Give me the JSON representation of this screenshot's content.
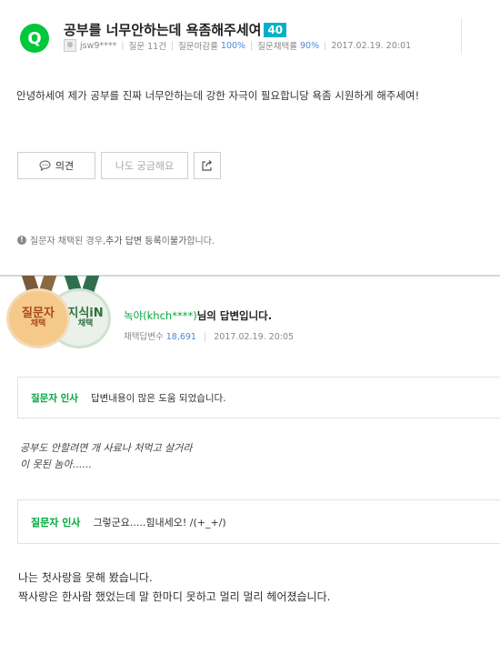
{
  "question": {
    "badge": "Q",
    "title": "공부를 너무안하는데 욕좀해주세여",
    "points": "40",
    "author": "jsw9****",
    "meta": {
      "questions_label": "질문",
      "questions_value": "11건",
      "close_rate_label": "질문마감률",
      "close_rate_value": "100%",
      "adopt_rate_label": "질문채택률",
      "adopt_rate_value": "90%",
      "date": "2017.02.19. 20:01"
    },
    "body": "안녕하세여 제가 공부를 진짜 너무안하는데 강한 자극이 필요합니당 욕좀 시원하게 해주세여!"
  },
  "actions": {
    "opinion_label": "의견",
    "curious_label": "나도 궁금해요",
    "share_icon": "share-icon"
  },
  "notice": {
    "icon": "info-icon",
    "text_prefix": "질문자 채택된 경우, ",
    "text_bold1": "추가 답변 등록",
    "text_mid": "이 ",
    "text_bold2": "불가",
    "text_suffix": "합니다."
  },
  "answer": {
    "medal1_line1": "질문자",
    "medal1_line2": "채택",
    "medal2_line1": "지식iN",
    "medal2_line2": "채택",
    "user_id": "녹야(khch****)",
    "title_suffix": "님의 답변입니다.",
    "adopt_label": "채택답변수",
    "adopt_count": "18,691",
    "date": "2017.02.19. 20:05"
  },
  "thanks1": {
    "label": "질문자 인사",
    "message": "답변내용이 많은 도움 되었습니다."
  },
  "handwritten": {
    "line1": "공부도 안할려면 개 사료나 처먹고 살거라",
    "line2": "이 못된 놈아......"
  },
  "thanks2": {
    "label": "질문자 인사",
    "message": "그렇군요.....힘내세오! /(+_+/)"
  },
  "answer_body": {
    "line1": "나는 첫사랑을 못해 봤습니다.",
    "line2": "짝사랑은 한사람 했었는데 말 한마디 못하고 멀리 멀리 헤어졌습니다."
  },
  "colors": {
    "brand_green": "#00c73c",
    "points_blue": "#00b2c9",
    "link_blue": "#4a8bd5"
  }
}
